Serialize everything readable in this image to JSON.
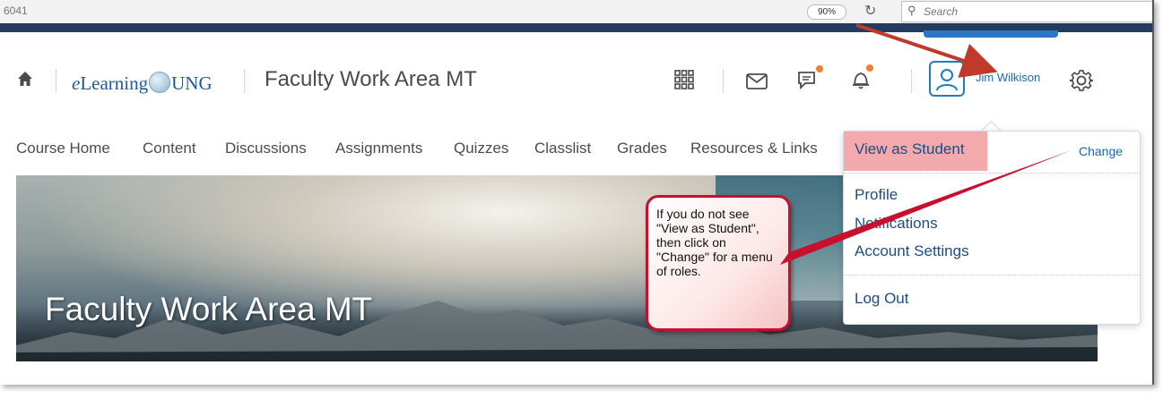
{
  "browser": {
    "url_fragment": "6041",
    "zoom": "90%",
    "search_placeholder": "Search"
  },
  "header": {
    "logo_e": "e",
    "logo_learning": "Learning",
    "logo_ung": "UNG",
    "org_title": "Faculty Work Area MT",
    "user_name": "Jim Wilkison",
    "icons": [
      "home-icon",
      "waffle-grid-icon",
      "mail-icon",
      "chat-icon",
      "bell-icon",
      "user-avatar-icon",
      "gear-icon"
    ]
  },
  "nav": {
    "items": [
      "Course Home",
      "Content",
      "Discussions",
      "Assignments",
      "Quizzes",
      "Classlist",
      "Grades",
      "Resources & Links"
    ]
  },
  "banner": {
    "title": "Faculty Work Area MT"
  },
  "menu": {
    "view_as": "View as Student",
    "change": "Change",
    "profile": "Profile",
    "notifications": "Notifications",
    "account_settings": "Account Settings",
    "logout": "Log Out"
  },
  "callout": {
    "text": "If you do not see \"View as Student\", then click on \"Change\" for a menu of roles."
  },
  "colors": {
    "highlight": "#f4a9ad",
    "link": "#1a68b4",
    "arrow": "#c0392b",
    "notification_dot": "#f0802c"
  }
}
